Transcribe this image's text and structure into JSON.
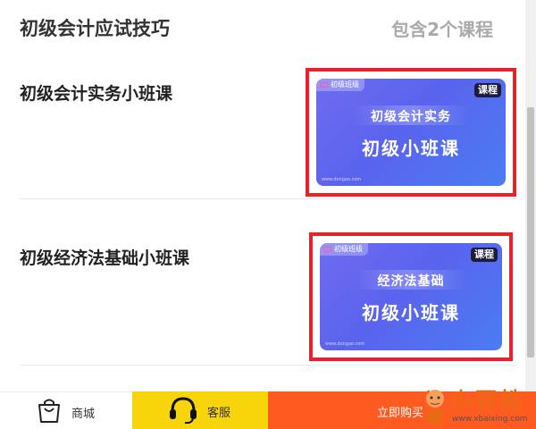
{
  "header": {
    "title": "初级会计应试技巧",
    "count": "包含2个课程"
  },
  "courses": [
    {
      "title": "初级会计实务小班课",
      "thumb_tag": "初级班级",
      "badge": "课程",
      "line1": "初级会计实务",
      "line2": "初级小班课",
      "site": "www.dongao.com"
    },
    {
      "title": "初级经济法基础小班课",
      "thumb_tag": "初级班级",
      "badge": "课程",
      "line1": "经济法基础",
      "line2": "初级小班课",
      "site": "www.dongao.com"
    }
  ],
  "bottom_bar": {
    "shop_label": "商城",
    "service_label": "客服",
    "buy_label": "立即购买"
  },
  "watermark": {
    "text": "小百姓",
    "url": "www.xbaixing.com"
  },
  "colors": {
    "highlight_frame": "#e6232b",
    "service_bg": "#f8d40a",
    "buy_bg": "#ff5a1f",
    "thumb_gradient_start": "#6f6cf0",
    "thumb_gradient_end": "#4a7df2"
  }
}
